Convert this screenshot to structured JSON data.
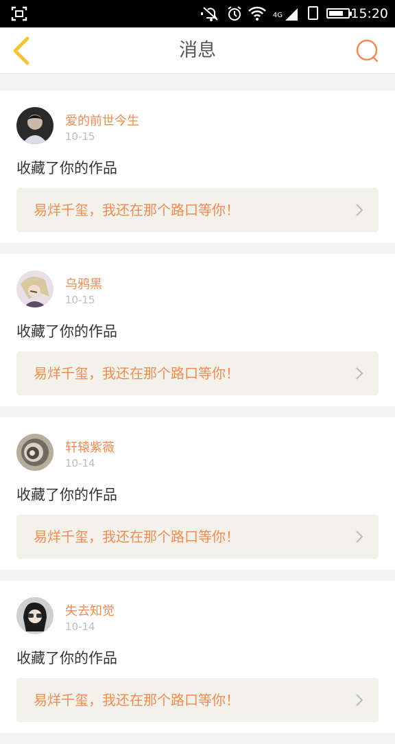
{
  "status_bar": {
    "time": "15:20",
    "network": "4G",
    "icons": [
      "screenshot-icon",
      "mute-icon",
      "alarm-icon",
      "wifi-icon",
      "signal-icon",
      "sim-icon",
      "battery-icon"
    ]
  },
  "header": {
    "title": "消息",
    "back_icon": "chevron-left-icon",
    "search_icon": "search-icon"
  },
  "colors": {
    "accent": "#f08b54",
    "back_icon": "#f2c43a",
    "work_bg": "#f2f2ea",
    "page_bg": "#f4f4f4"
  },
  "messages": [
    {
      "user": "爱的前世今生",
      "date": "10-15",
      "action": "收藏了你的作品",
      "work_title": "易烊千玺，我还在那个路口等你！",
      "avatar": "avatar-photo-boy"
    },
    {
      "user": "乌鸦黑",
      "date": "10-15",
      "action": "收藏了你的作品",
      "work_title": "易烊千玺，我还在那个路口等你！",
      "avatar": "avatar-anime-character"
    },
    {
      "user": "轩辕紫薇",
      "date": "10-14",
      "action": "收藏了你的作品",
      "work_title": "易烊千玺，我还在那个路口等你！",
      "avatar": "avatar-swirl"
    },
    {
      "user": "失去知觉",
      "date": "10-14",
      "action": "收藏了你的作品",
      "work_title": "易烊千玺，我还在那个路口等你！",
      "avatar": "avatar-photo-girl"
    }
  ]
}
